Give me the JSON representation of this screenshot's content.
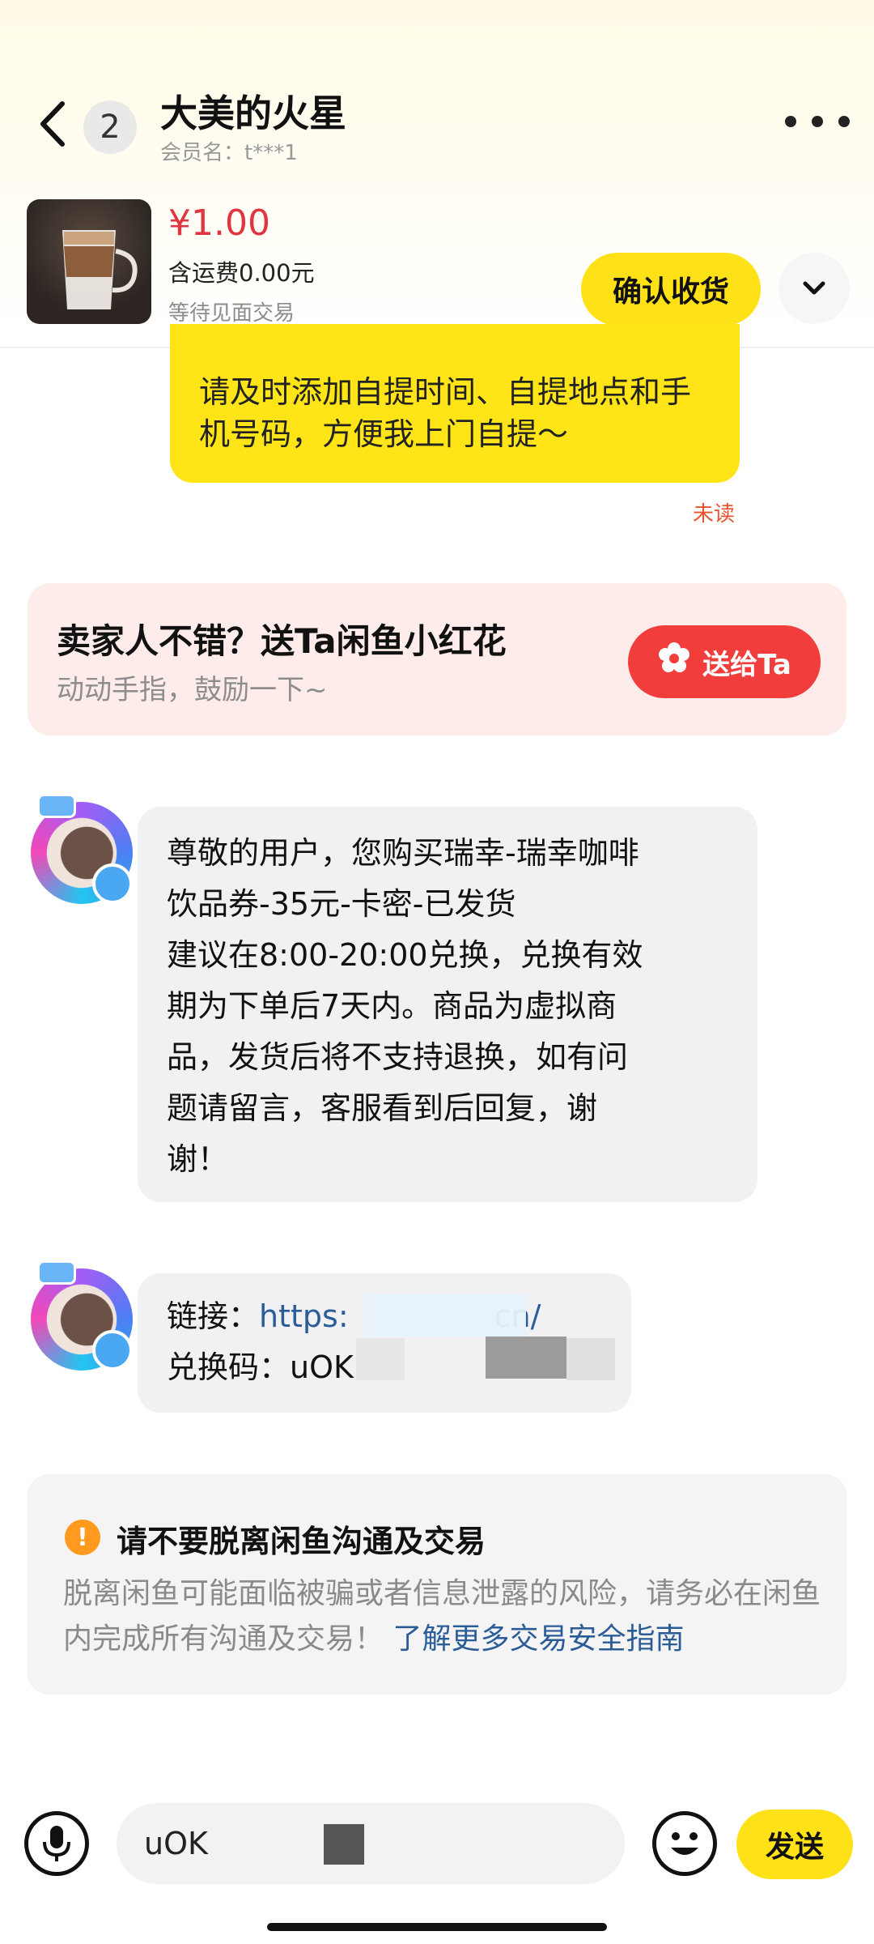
{
  "header": {
    "back_icon": "chevron-left-icon",
    "unread_count": "2",
    "title": "大美的火星",
    "member_name": "会员名：t***1",
    "more_icon": "more-horizontal-icon"
  },
  "order": {
    "price": "¥1.00",
    "shipping": "含运费0.00元",
    "status": "等待见面交易",
    "confirm_label": "确认收货",
    "expand_icon": "chevron-down-icon"
  },
  "my_message": {
    "text": "请及时添加自提时间、自提地点和手机号码，方便我上门自提～",
    "read_status": "未读",
    "bubble_color": "#ffe417"
  },
  "flower_card": {
    "title": "卖家人不错？送Ta闲鱼小红花",
    "subtitle": "动动手指，鼓励一下~",
    "button_label": "送给Ta",
    "button_icon": "flower-icon",
    "accent": "#f23d3d"
  },
  "messages": [
    {
      "lines": [
        "尊敬的用户，您购买瑞幸-瑞幸咖啡",
        "饮品券-35元-卡密-已发货",
        "建议在8:00-20:00兑换，兑换有效",
        "期为下单后7天内。商品为虚拟商",
        "品，发货后将不支持退换，如有问",
        "题请留言，客服看到后回复，谢",
        "谢！"
      ]
    },
    {
      "link_label": "链接：",
      "link_text": "https:",
      "link_tail": "cn/",
      "code_label": "兑换码：",
      "code_text": "uOK"
    }
  ],
  "notice": {
    "icon": "warning-icon",
    "title": "请不要脱离闲鱼沟通及交易",
    "body": "脱离闲鱼可能面临被骗或者信息泄露的风险，请务必在闲鱼内完成所有沟通及交易！",
    "link": "了解更多交易安全指南",
    "link_color": "#2a5c97"
  },
  "composer": {
    "mic_icon": "microphone-icon",
    "input_value": "uOK",
    "emoji_icon": "emoji-icon",
    "send_label": "发送",
    "accent": "#ffe117"
  }
}
